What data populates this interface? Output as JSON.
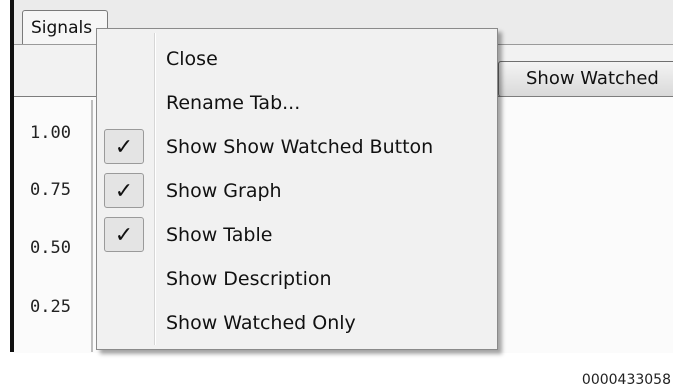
{
  "tab": {
    "label": "Signals"
  },
  "toolbar": {
    "show_watched_label": "Show Watched"
  },
  "graph": {
    "y_ticks": [
      "1.00",
      "0.75",
      "0.50",
      "0.25"
    ]
  },
  "menu": {
    "items": [
      {
        "label": "Close",
        "checked": false
      },
      {
        "label": "Rename Tab...",
        "checked": false
      },
      {
        "label": "Show Show Watched Button",
        "checked": true
      },
      {
        "label": "Show Graph",
        "checked": true
      },
      {
        "label": "Show Table",
        "checked": true
      },
      {
        "label": "Show Description",
        "checked": false
      },
      {
        "label": "Show Watched Only",
        "checked": false
      }
    ],
    "check_glyph": "✓"
  },
  "footer": {
    "image_id": "0000433058"
  }
}
